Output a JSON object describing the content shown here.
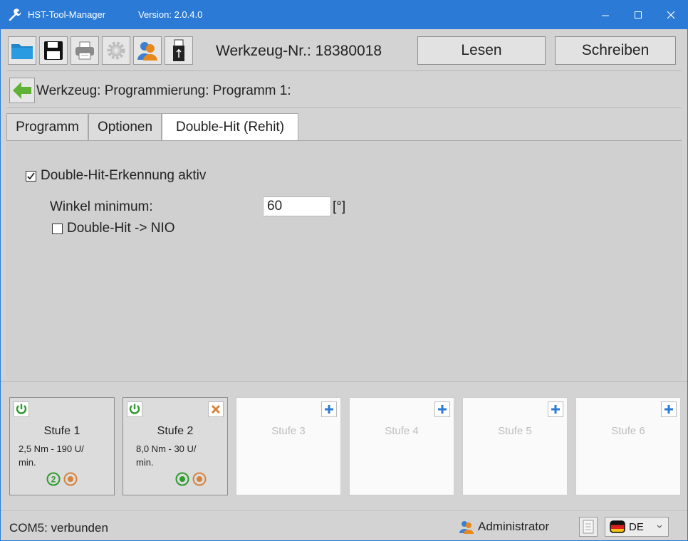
{
  "titlebar": {
    "title": "HST-Tool-Manager",
    "version": "Version: 2.0.4.0",
    "accent": "#2b7bd6"
  },
  "toolbar": {
    "icons": [
      "folder-icon",
      "save-icon",
      "print-icon",
      "settings-icon",
      "user-icon",
      "usb-icon"
    ],
    "tool_number": "Werkzeug-Nr.: 18380018",
    "read_label": "Lesen",
    "write_label": "Schreiben"
  },
  "breadcrumb": {
    "text": "Werkzeug: Programmierung: Programm 1:"
  },
  "tabs": [
    {
      "label": "Programm",
      "active": false
    },
    {
      "label": "Optionen",
      "active": false
    },
    {
      "label": "Double-Hit (Rehit)",
      "active": true
    }
  ],
  "double_hit": {
    "enabled_label": "Double-Hit-Erkennung aktiv",
    "enabled": true,
    "angle_label": "Winkel minimum:",
    "angle_value": "60",
    "angle_unit": "[°]",
    "nio_label": "Double-Hit -> NIO",
    "nio": false
  },
  "stages": [
    {
      "name": "Stufe 1",
      "line1": "2,5 Nm - 190 U/",
      "line2": "min.",
      "active": true
    },
    {
      "name": "Stufe 2",
      "line1": "8,0 Nm - 30 U/",
      "line2": "min.",
      "active": true
    },
    {
      "name": "Stufe 3",
      "active": false
    },
    {
      "name": "Stufe 4",
      "active": false
    },
    {
      "name": "Stufe 5",
      "active": false
    },
    {
      "name": "Stufe 6",
      "active": false
    }
  ],
  "statusbar": {
    "connection": "COM5: verbunden",
    "user": "Administrator",
    "language": "DE"
  },
  "colors": {
    "green": "#3a9a3a",
    "orange": "#d9823a",
    "blue": "#2b7bd6"
  }
}
